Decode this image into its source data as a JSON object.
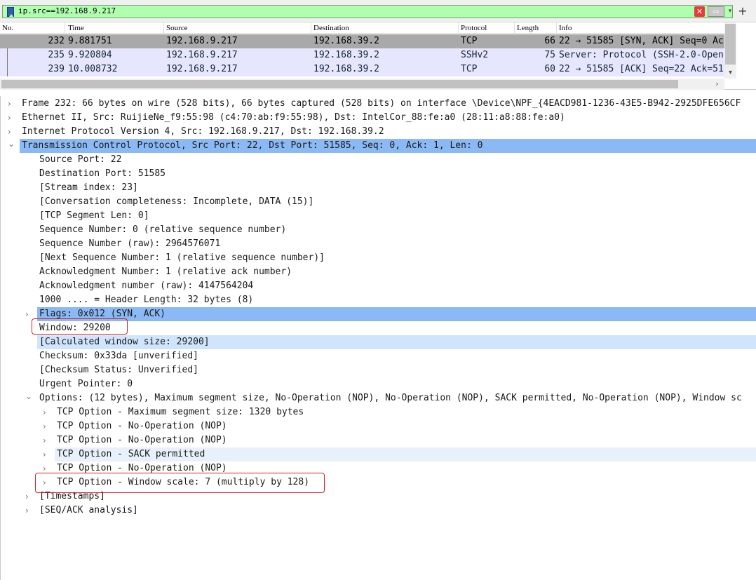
{
  "filter": {
    "value": "ip.src==192.168.9.217",
    "clear_glyph": "✕",
    "apply_glyph": "⇨",
    "dropdown_glyph": "▾",
    "add_glyph": "+"
  },
  "icons": {
    "bookmark": "bookmark-icon",
    "clear": "clear-filter-icon",
    "apply": "apply-arrow-icon",
    "dropdown": "chevron-down-icon",
    "add": "plus-icon",
    "expand": "chevron-right-icon",
    "collapse": "chevron-down-icon"
  },
  "packet_list": {
    "columns": [
      "No.",
      "Time",
      "Source",
      "Destination",
      "Protocol",
      "Length",
      "Info"
    ],
    "rows": [
      {
        "no": "232",
        "time": "9.881751",
        "src": "192.168.9.217",
        "dst": "192.168.39.2",
        "proto": "TCP",
        "len": "66",
        "info": "22 → 51585 [SYN, ACK] Seq=0 Ac",
        "selected": true
      },
      {
        "no": "235",
        "time": "9.920804",
        "src": "192.168.9.217",
        "dst": "192.168.39.2",
        "proto": "SSHv2",
        "len": "75",
        "info": "Server: Protocol (SSH-2.0-Open",
        "selected": false
      },
      {
        "no": "239",
        "time": "10.008732",
        "src": "192.168.9.217",
        "dst": "192.168.39.2",
        "proto": "TCP",
        "len": "60",
        "info": "22 → 51585 [ACK] Seq=22 Ack=51",
        "selected": false
      }
    ],
    "scroll_up_glyph": "▲",
    "scroll_down_glyph": "▾",
    "scroll_right_glyph": "›"
  },
  "details": {
    "expand_glyph": "›",
    "collapse_glyph": "⌄",
    "rows": [
      {
        "text": "Frame 232: 66 bytes on wire (528 bits), 66 bytes captured (528 bits) on interface \\Device\\NPF_{4EACD981-1236-43E5-B942-2925DFE656CF",
        "indent": 0,
        "arrow": "collapsed",
        "highlight": "none"
      },
      {
        "text": "Ethernet II, Src: RuijieNe_f9:55:98 (c4:70:ab:f9:55:98), Dst: IntelCor_88:fe:a0 (28:11:a8:88:fe:a0)",
        "indent": 0,
        "arrow": "collapsed",
        "highlight": "none"
      },
      {
        "text": "Internet Protocol Version 4, Src: 192.168.9.217, Dst: 192.168.39.2",
        "indent": 0,
        "arrow": "collapsed",
        "highlight": "none"
      },
      {
        "text": "Transmission Control Protocol, Src Port: 22, Dst Port: 51585, Seq: 0, Ack: 1, Len: 0",
        "indent": 0,
        "arrow": "expanded",
        "highlight": "dark-full"
      },
      {
        "text": "Source Port: 22",
        "indent": 1,
        "arrow": "none",
        "highlight": "none"
      },
      {
        "text": "Destination Port: 51585",
        "indent": 1,
        "arrow": "none",
        "highlight": "none"
      },
      {
        "text": "[Stream index: 23]",
        "indent": 1,
        "arrow": "none",
        "highlight": "none"
      },
      {
        "text": "[Conversation completeness: Incomplete, DATA (15)]",
        "indent": 1,
        "arrow": "none",
        "highlight": "none"
      },
      {
        "text": "[TCP Segment Len: 0]",
        "indent": 1,
        "arrow": "none",
        "highlight": "none"
      },
      {
        "text": "Sequence Number: 0    (relative sequence number)",
        "indent": 1,
        "arrow": "none",
        "highlight": "none"
      },
      {
        "text": "Sequence Number (raw): 2964576071",
        "indent": 1,
        "arrow": "none",
        "highlight": "none"
      },
      {
        "text": "[Next Sequence Number: 1    (relative sequence number)]",
        "indent": 1,
        "arrow": "none",
        "highlight": "none"
      },
      {
        "text": "Acknowledgment Number: 1    (relative ack number)",
        "indent": 1,
        "arrow": "none",
        "highlight": "none"
      },
      {
        "text": "Acknowledgment number (raw): 4147564204",
        "indent": 1,
        "arrow": "none",
        "highlight": "none"
      },
      {
        "text": "1000 .... = Header Length: 32 bytes (8)",
        "indent": 1,
        "arrow": "none",
        "highlight": "none"
      },
      {
        "text": "Flags: 0x012 (SYN, ACK)",
        "indent": 1,
        "arrow": "collapsed",
        "highlight": "dark-full"
      },
      {
        "text": "Window: 29200",
        "indent": 1,
        "arrow": "none",
        "highlight": "none"
      },
      {
        "text": "[Calculated window size: 29200]",
        "indent": 1,
        "arrow": "none",
        "highlight": "light-full"
      },
      {
        "text": "Checksum: 0x33da [unverified]",
        "indent": 1,
        "arrow": "none",
        "highlight": "none"
      },
      {
        "text": "[Checksum Status: Unverified]",
        "indent": 1,
        "arrow": "none",
        "highlight": "none"
      },
      {
        "text": "Urgent Pointer: 0",
        "indent": 1,
        "arrow": "none",
        "highlight": "none"
      },
      {
        "text": "Options: (12 bytes), Maximum segment size, No-Operation (NOP), No-Operation (NOP), SACK permitted, No-Operation (NOP), Window sc",
        "indent": 1,
        "arrow": "expanded",
        "highlight": "none"
      },
      {
        "text": "TCP Option - Maximum segment size: 1320 bytes",
        "indent": 2,
        "arrow": "collapsed",
        "highlight": "none"
      },
      {
        "text": "TCP Option - No-Operation (NOP)",
        "indent": 2,
        "arrow": "collapsed",
        "highlight": "none"
      },
      {
        "text": "TCP Option - No-Operation (NOP)",
        "indent": 2,
        "arrow": "collapsed",
        "highlight": "none"
      },
      {
        "text": "TCP Option - SACK permitted",
        "indent": 2,
        "arrow": "collapsed",
        "highlight": "faint-full"
      },
      {
        "text": "TCP Option - No-Operation (NOP)",
        "indent": 2,
        "arrow": "collapsed",
        "highlight": "none"
      },
      {
        "text": "TCP Option - Window scale: 7 (multiply by 128)",
        "indent": 2,
        "arrow": "collapsed",
        "highlight": "none"
      },
      {
        "text": "[Timestamps]",
        "indent": 1,
        "arrow": "collapsed",
        "highlight": "none"
      },
      {
        "text": "[SEQ/ACK analysis]",
        "indent": 1,
        "arrow": "collapsed",
        "highlight": "none"
      }
    ]
  },
  "colors": {
    "filter_valid_bg": "#afffaf",
    "selected_row_bg": "#a9a9a9",
    "normal_row_bg": "#e7e6ff",
    "detail_highlight": "#8ab9f5",
    "detail_light": "#cfe5fc",
    "annotation_red": "#d42020"
  }
}
